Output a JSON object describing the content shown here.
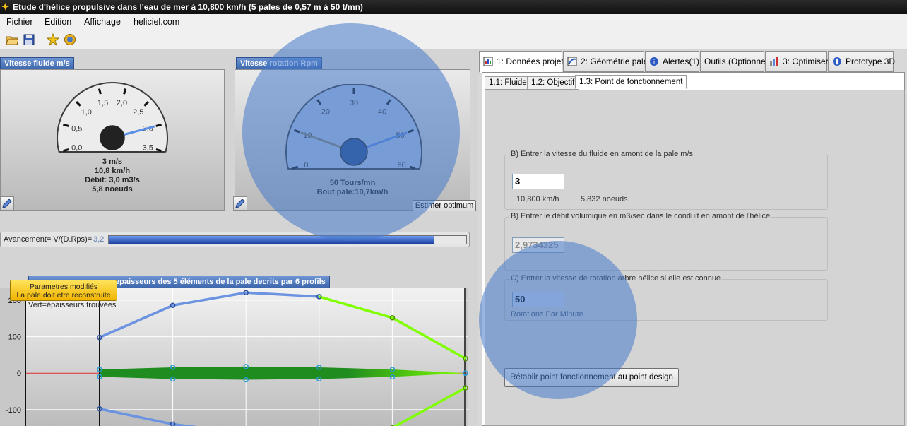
{
  "window": {
    "title": "Etude d'hélice propulsive dans l'eau de mer à 10,800 km/h (5 pales de 0,57 m à 50 t/mn)"
  },
  "menu": {
    "items": [
      "Fichier",
      "Edition",
      "Affichage",
      "heliciel.com"
    ]
  },
  "toolbar": {
    "buttons": [
      "open-folder-icon",
      "save-disk-icon",
      "star-icon",
      "globe-icon"
    ]
  },
  "gauge_fluid": {
    "label": "Vitesse fluide m/s",
    "ticks": [
      "0,0",
      "0,5",
      "1,0",
      "1,5",
      "2,0",
      "2,5",
      "3,0",
      "3,5"
    ],
    "readout": [
      "3 m/s",
      "10,8 km/h",
      "Débit: 3,0 m3/s",
      "5,8 noeuds"
    ],
    "needle_value": 3.0,
    "range": [
      0,
      3.5
    ]
  },
  "gauge_rpm": {
    "label": "Vitesse rotation Rpm",
    "ticks": [
      "0",
      "10",
      "20",
      "30",
      "40",
      "50",
      "60"
    ],
    "readout": [
      "50 Tours/mn",
      "Bout pale:10,7km/h"
    ],
    "needle_value": 50,
    "secondary_needle_value": 10,
    "range": [
      0,
      60
    ]
  },
  "buttons": {
    "estimate": "Estimer optimum",
    "reset_point": "Rétablir point fonctionnement au point design"
  },
  "advance": {
    "label": "Avancement= V/(D.Rps)=",
    "value": "3,2",
    "fill_fraction": 0.91
  },
  "warning": {
    "line1": "Parametres modifiés",
    "line2": "La pale doit etre reconstruite"
  },
  "chart_panel": {
    "label": "epaisseurs des 5 éléments de la pale decrits par 6 profils",
    "sublabel": "Vert=épaisseurs trouvées"
  },
  "chart_data": {
    "type": "line",
    "yticks": [
      "200",
      "100",
      "0",
      "-100"
    ],
    "ylim": [
      -145,
      235
    ],
    "x": [
      0,
      1,
      2,
      3,
      4,
      5
    ],
    "series": [
      {
        "values": [
          98,
          186,
          221,
          210,
          152,
          40
        ],
        "color": "#6b93e0"
      },
      {
        "values": [
          -98,
          -140,
          -165,
          -160,
          -150,
          -40
        ],
        "color": "#6b93e0"
      },
      {
        "values": [
          10,
          16,
          18,
          16,
          10,
          0
        ],
        "color": "#1f8c1f"
      },
      {
        "values": [
          -10,
          -16,
          -18,
          -16,
          -10,
          0
        ],
        "color": "#1f8c1f"
      }
    ]
  },
  "tabs": [
    {
      "label": "1: Données projet",
      "icon": "project-data-icon",
      "active": true
    },
    {
      "label": "2: Géométrie pale",
      "icon": "blade-geometry-icon",
      "active": false
    },
    {
      "label": "Alertes(1)",
      "icon": "alert-icon",
      "active": false
    },
    {
      "label": "Outils (Optionnel)",
      "icon": "",
      "active": false
    },
    {
      "label": "3: Optimiser",
      "icon": "optimize-icon",
      "active": false
    },
    {
      "label": "Prototype 3D",
      "icon": "prototype-3d-icon",
      "active": false
    }
  ],
  "subtabs": [
    {
      "label": "1.1: Fluide",
      "active": false
    },
    {
      "label": "1.2: Objectif",
      "active": false
    },
    {
      "label": "1.3: Point de fonctionnement",
      "active": true
    }
  ],
  "group_speed": {
    "title": "B) Entrer la vitesse du fluide en amont de la pale m/s",
    "value": "3",
    "kmh": "10,800 km/h",
    "knots": "5,832 noeuds"
  },
  "group_flow": {
    "title": "B) Entrer le débit volumique en m3/sec dans le conduit  en amont de l'hélice",
    "value": "2,9734325"
  },
  "group_rotation": {
    "title": "C) Entrer la vitesse de rotation arbre hélice  si elle est connue",
    "value": "50",
    "unit": "Rotations Par Minute"
  },
  "colors": {
    "accent": "#3d67ad",
    "overlay": "#4678c8",
    "chart_green": "#1f8c1f",
    "chart_lime": "#80ff00",
    "chart_blue": "#6b93e0"
  }
}
